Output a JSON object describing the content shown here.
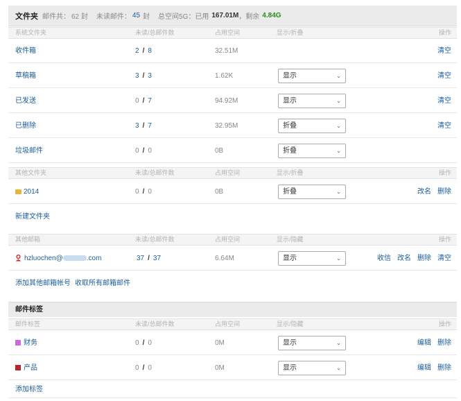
{
  "summary": {
    "title": "文件夹",
    "total_label": "邮件共：",
    "total_value": "62 封",
    "unread_label": "未读邮件：",
    "unread_value": "45",
    "unread_unit": "封",
    "space_label": "总空间5G：已用",
    "used_value": "167.01M",
    "remain_label": "，剩余",
    "remain_value": "4.84G"
  },
  "system_header": {
    "col1": "系统文件夹",
    "col2": "未读/总邮件数",
    "col3": "占用空间",
    "col4": "显示/折叠",
    "col5": "操作"
  },
  "system_folders": [
    {
      "name": "收件箱",
      "unread": "2",
      "total": "8",
      "size": "32.51M",
      "select": "",
      "actions": [
        "清空"
      ]
    },
    {
      "name": "草稿箱",
      "unread": "3",
      "total": "3",
      "size": "1.62K",
      "select": "显示",
      "actions": [
        "清空"
      ]
    },
    {
      "name": "已发送",
      "unread": "0",
      "total": "7",
      "size": "94.92M",
      "select": "显示",
      "actions": [
        "清空"
      ]
    },
    {
      "name": "已删除",
      "unread": "3",
      "total": "7",
      "size": "32.95M",
      "select": "折叠",
      "actions": [
        "清空"
      ]
    },
    {
      "name": "垃圾邮件",
      "unread": "0",
      "total": "0",
      "size": "0B",
      "select": "折叠",
      "actions": []
    }
  ],
  "other_header": {
    "col1": "其他文件夹",
    "col2": "未读/总邮件数",
    "col3": "占用空间",
    "col4": "显示/折叠",
    "col5": "操作"
  },
  "other_folders": [
    {
      "name": "2014",
      "unread": "0",
      "total": "0",
      "size": "0B",
      "select": "折叠",
      "actions": [
        "改名",
        "删除"
      ]
    }
  ],
  "new_folder_label": "新建文件夹",
  "mailbox_header": {
    "col1": "其他邮箱",
    "col2": "未读/总邮件数",
    "col3": "占用空间",
    "col4": "显示/隐藏",
    "col5": "操作"
  },
  "mailboxes": [
    {
      "name_prefix": "hzluochen@",
      "name_suffix": ".com",
      "unread": "37",
      "total": "37",
      "size": "6.64M",
      "select": "显示",
      "actions": [
        "收信",
        "改名",
        "删除",
        "清空"
      ]
    }
  ],
  "mailbox_links": {
    "add": "添加其他邮箱帐号",
    "fetch_all": "收取所有邮箱邮件"
  },
  "tags_section_title": "邮件标签",
  "tags_header": {
    "col1": "邮件标签",
    "col2": "未读/总邮件数",
    "col3": "占用空间",
    "col4": "显示/隐藏",
    "col5": "操作"
  },
  "tags": [
    {
      "name": "财务",
      "color": "#c86dd7",
      "unread": "0",
      "total": "0",
      "size": "0M",
      "select": "显示",
      "actions": [
        "编辑",
        "删除"
      ]
    },
    {
      "name": "产品",
      "color": "#b3282d",
      "unread": "0",
      "total": "0",
      "size": "0M",
      "select": "显示",
      "actions": [
        "编辑",
        "删除"
      ]
    }
  ],
  "add_tag_label": "添加标签",
  "icons": {
    "folder": "folder-icon",
    "user": "user-icon",
    "dropdown": "chevron-down-icon"
  },
  "colors": {
    "link": "#1a5c9a",
    "remain": "#2e8b1a",
    "folder": "#e8b53c"
  }
}
